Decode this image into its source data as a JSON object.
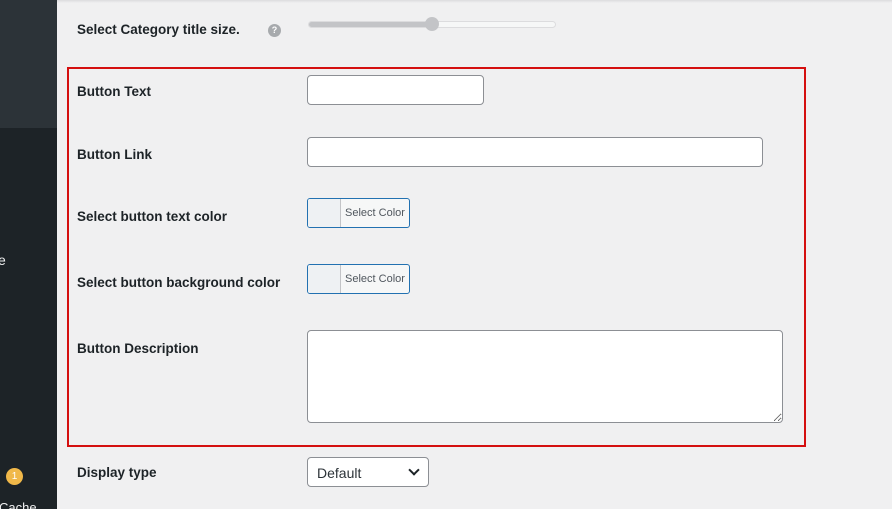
{
  "sidebar": {
    "fragment_text": "e",
    "badge_count": "1",
    "bottom_fragment": "Cache"
  },
  "category_title_size": {
    "label": "Select Category title size.",
    "help_icon": "?",
    "slider_value_fraction": 0.5
  },
  "button_text": {
    "label": "Button Text",
    "value": ""
  },
  "button_link": {
    "label": "Button Link",
    "value": ""
  },
  "button_text_color": {
    "label": "Select button text color",
    "button_label": "Select Color"
  },
  "button_bg_color": {
    "label": "Select button background color",
    "button_label": "Select Color"
  },
  "button_description": {
    "label": "Button Description",
    "value": ""
  },
  "display_type": {
    "label": "Display type",
    "selected": "Default"
  },
  "colors": {
    "accent": "#2271b1",
    "highlight_border": "#d40f0f",
    "badge": "#f0b849"
  },
  "icons": [
    "help-icon",
    "chevron-down-icon"
  ]
}
